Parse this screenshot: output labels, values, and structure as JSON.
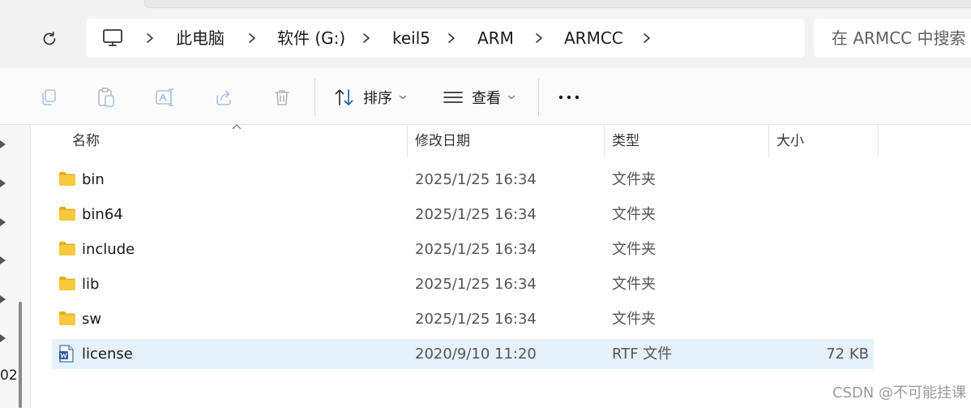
{
  "address_bar": {
    "crumbs": [
      "此电脑",
      "软件 (G:)",
      "keil5",
      "ARM",
      "ARMCC"
    ]
  },
  "search": {
    "placeholder": "在 ARMCC 中搜索"
  },
  "toolbar": {
    "sort_label": "排序",
    "view_label": "查看",
    "more_label": "···"
  },
  "nav": {
    "clipped_text": "02"
  },
  "columns": {
    "name": "名称",
    "date": "修改日期",
    "type": "类型",
    "size": "大小"
  },
  "files": [
    {
      "name": "bin",
      "date": "2025/1/25 16:34",
      "type": "文件夹",
      "size": "",
      "icon": "folder-icon"
    },
    {
      "name": "bin64",
      "date": "2025/1/25 16:34",
      "type": "文件夹",
      "size": "",
      "icon": "folder-icon"
    },
    {
      "name": "include",
      "date": "2025/1/25 16:34",
      "type": "文件夹",
      "size": "",
      "icon": "folder-icon"
    },
    {
      "name": "lib",
      "date": "2025/1/25 16:34",
      "type": "文件夹",
      "size": "",
      "icon": "folder-icon"
    },
    {
      "name": "sw",
      "date": "2025/1/25 16:34",
      "type": "文件夹",
      "size": "",
      "icon": "folder-icon"
    },
    {
      "name": "license",
      "date": "2020/9/10 11:20",
      "type": "RTF 文件",
      "size": "72 KB",
      "icon": "word-document-icon",
      "selected": true
    }
  ],
  "watermark": "CSDN @不可能挂课",
  "colors": {
    "folder": "#f8c93d",
    "folder_dark": "#e8ac1c",
    "selection": "#e5f1fb",
    "word_blue": "#2b5797"
  }
}
